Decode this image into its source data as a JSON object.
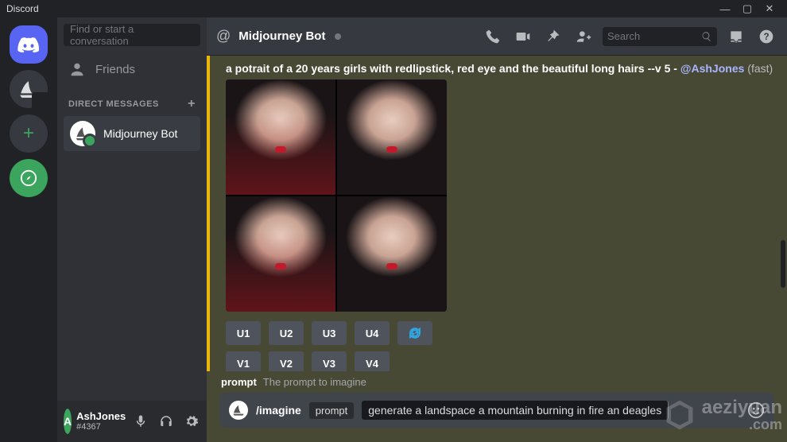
{
  "app_title": "Discord",
  "window": {
    "min": "—",
    "max": "▢",
    "close": "✕"
  },
  "dm": {
    "search_placeholder": "Find or start a conversation",
    "friends_label": "Friends",
    "section": "DIRECT MESSAGES",
    "items": [
      {
        "name": "Midjourney Bot"
      }
    ]
  },
  "user": {
    "name": "AshJones",
    "tag": "#4367"
  },
  "header": {
    "title": "Midjourney Bot",
    "search_placeholder": "Search"
  },
  "message": {
    "prompt_text": "a potrait of a 20 years girls with redlipstick, red eye and the beautiful long hairs --v 5",
    "sep": " - ",
    "mention": "@AshJones",
    "mode": " (fast)",
    "u": [
      "U1",
      "U2",
      "U3",
      "U4"
    ],
    "v": [
      "V1",
      "V2",
      "V3",
      "V4"
    ]
  },
  "composer": {
    "tip_label": "prompt",
    "tip_desc": "The prompt to imagine",
    "command": "/imagine",
    "chip": "prompt",
    "value": "generate a landspace a mountain burning in fire an deagles"
  },
  "watermark": {
    "line1": "aeziyuan",
    "line2": ".com"
  }
}
